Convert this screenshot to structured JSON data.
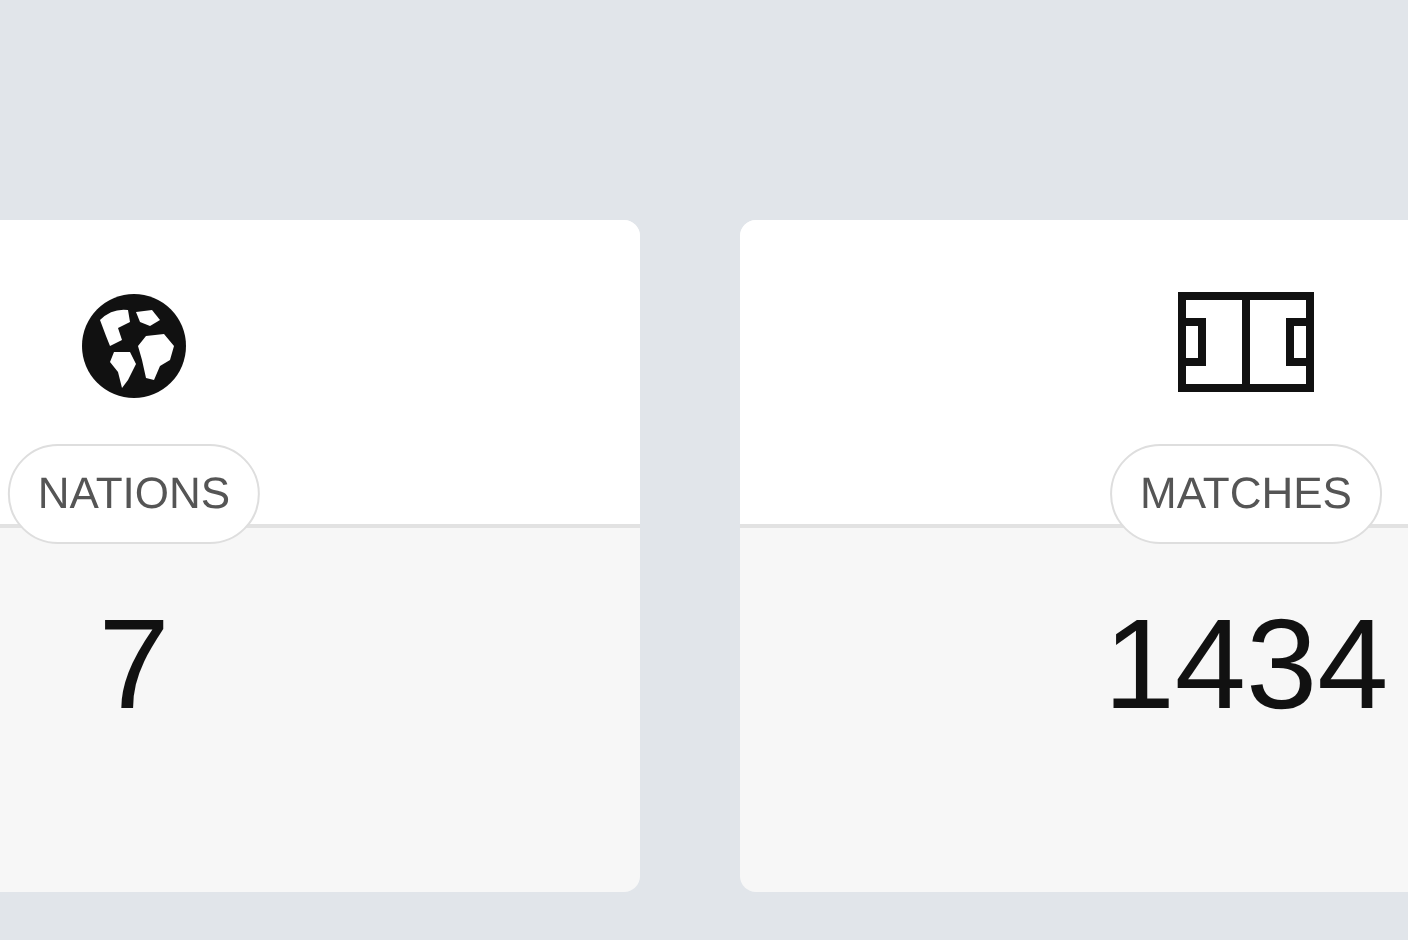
{
  "cards": [
    {
      "kind": "globe",
      "label": "NATIONS",
      "value": "7"
    },
    {
      "kind": "pitch",
      "label": "MATCHES",
      "value": "1434"
    }
  ]
}
